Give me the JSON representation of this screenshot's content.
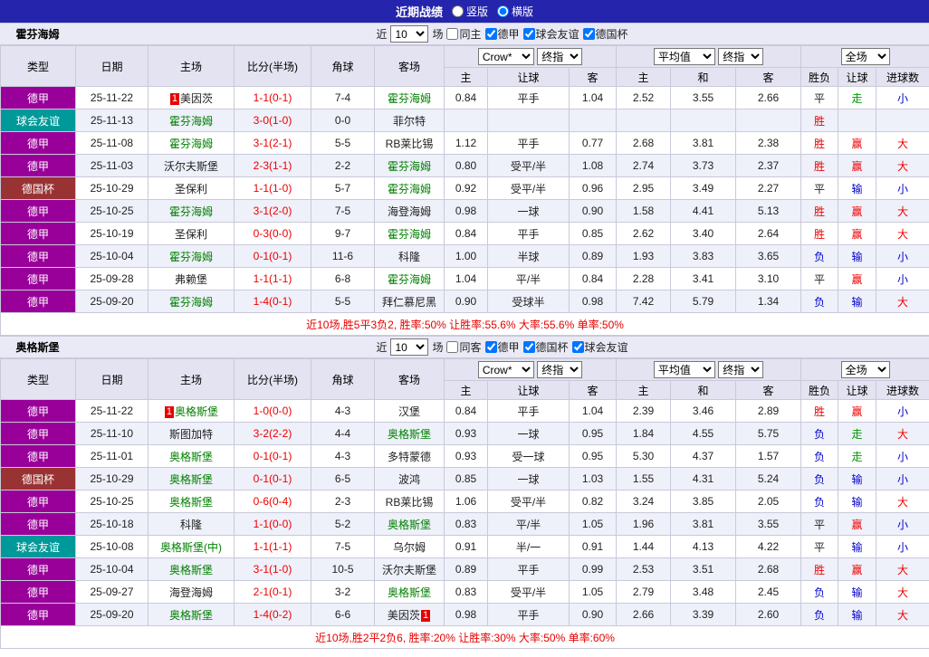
{
  "topbar": {
    "title": "近期战绩",
    "radios": [
      {
        "label": "竖版",
        "checked": false
      },
      {
        "label": "横版",
        "checked": true
      }
    ]
  },
  "colors": {
    "topbar_bg": "#2424ac",
    "leagues": {
      "德甲": "#990099",
      "球会友谊": "#009999",
      "德国杯": "#993333"
    },
    "focus_team": "#008000",
    "score": "#ee0000",
    "summary": "#e60000",
    "results": {
      "胜": "#ee0000",
      "平": "#222222",
      "负": "#0000cc",
      "赢": "#ee0000",
      "走": "#009900",
      "输": "#0000cc",
      "大": "#ee0000",
      "小": "#0000cc"
    }
  },
  "table_header": {
    "cols": [
      "类型",
      "日期",
      "主场",
      "比分(半场)",
      "角球",
      "客场"
    ],
    "selects": {
      "odds_source": "Crow*",
      "odds_stage": "终指",
      "avg_source": "平均值",
      "avg_stage": "终指",
      "scope": "全场"
    },
    "sub": [
      "主",
      "让球",
      "客",
      "主",
      "和",
      "客",
      "胜负",
      "让球",
      "进球数"
    ]
  },
  "sections": [
    {
      "team": "霍芬海姆",
      "filters": {
        "prefix": "近",
        "count": "10",
        "suffix": "场",
        "same_label": "同主",
        "same_checked": false,
        "leagues": [
          {
            "label": "德甲",
            "checked": true
          },
          {
            "label": "球会友谊",
            "checked": true
          },
          {
            "label": "德国杯",
            "checked": true
          }
        ]
      },
      "rows": [
        {
          "league": "德甲",
          "date": "25-11-22",
          "home": "美因茨",
          "home_focus": false,
          "home_badge": "1",
          "home_badge_pos": "before",
          "score": "1-1(0-1)",
          "corner": "7-4",
          "away": "霍芬海姆",
          "away_focus": true,
          "o1": "0.84",
          "hc": "平手",
          "o2": "1.04",
          "m1": "2.52",
          "m2": "3.55",
          "m3": "2.66",
          "r1": "平",
          "r2": "走",
          "r3": "小"
        },
        {
          "league": "球会友谊",
          "date": "25-11-13",
          "home": "霍芬海姆",
          "home_focus": true,
          "score": "3-0(1-0)",
          "corner": "0-0",
          "away": "菲尔特",
          "away_focus": false,
          "o1": "",
          "hc": "",
          "o2": "",
          "m1": "",
          "m2": "",
          "m3": "",
          "r1": "胜",
          "r2": "",
          "r3": ""
        },
        {
          "league": "德甲",
          "date": "25-11-08",
          "home": "霍芬海姆",
          "home_focus": true,
          "score": "3-1(2-1)",
          "corner": "5-5",
          "away": "RB莱比锡",
          "away_focus": false,
          "o1": "1.12",
          "hc": "平手",
          "o2": "0.77",
          "m1": "2.68",
          "m2": "3.81",
          "m3": "2.38",
          "r1": "胜",
          "r2": "赢",
          "r3": "大"
        },
        {
          "league": "德甲",
          "date": "25-11-03",
          "home": "沃尔夫斯堡",
          "home_focus": false,
          "score": "2-3(1-1)",
          "corner": "2-2",
          "away": "霍芬海姆",
          "away_focus": true,
          "o1": "0.80",
          "hc": "受平/半",
          "o2": "1.08",
          "m1": "2.74",
          "m2": "3.73",
          "m3": "2.37",
          "r1": "胜",
          "r2": "赢",
          "r3": "大"
        },
        {
          "league": "德国杯",
          "date": "25-10-29",
          "home": "圣保利",
          "home_focus": false,
          "score": "1-1(1-0)",
          "corner": "5-7",
          "away": "霍芬海姆",
          "away_focus": true,
          "o1": "0.92",
          "hc": "受平/半",
          "o2": "0.96",
          "m1": "2.95",
          "m2": "3.49",
          "m3": "2.27",
          "r1": "平",
          "r2": "输",
          "r3": "小"
        },
        {
          "league": "德甲",
          "date": "25-10-25",
          "home": "霍芬海姆",
          "home_focus": true,
          "score": "3-1(2-0)",
          "corner": "7-5",
          "away": "海登海姆",
          "away_focus": false,
          "o1": "0.98",
          "hc": "一球",
          "o2": "0.90",
          "m1": "1.58",
          "m2": "4.41",
          "m3": "5.13",
          "r1": "胜",
          "r2": "赢",
          "r3": "大"
        },
        {
          "league": "德甲",
          "date": "25-10-19",
          "home": "圣保利",
          "home_focus": false,
          "score": "0-3(0-0)",
          "corner": "9-7",
          "away": "霍芬海姆",
          "away_focus": true,
          "o1": "0.84",
          "hc": "平手",
          "o2": "0.85",
          "m1": "2.62",
          "m2": "3.40",
          "m3": "2.64",
          "r1": "胜",
          "r2": "赢",
          "r3": "大"
        },
        {
          "league": "德甲",
          "date": "25-10-04",
          "home": "霍芬海姆",
          "home_focus": true,
          "score": "0-1(0-1)",
          "corner": "11-6",
          "away": "科隆",
          "away_focus": false,
          "o1": "1.00",
          "hc": "半球",
          "o2": "0.89",
          "m1": "1.93",
          "m2": "3.83",
          "m3": "3.65",
          "r1": "负",
          "r2": "输",
          "r3": "小"
        },
        {
          "league": "德甲",
          "date": "25-09-28",
          "home": "弗赖堡",
          "home_focus": false,
          "score": "1-1(1-1)",
          "corner": "6-8",
          "away": "霍芬海姆",
          "away_focus": true,
          "o1": "1.04",
          "hc": "平/半",
          "o2": "0.84",
          "m1": "2.28",
          "m2": "3.41",
          "m3": "3.10",
          "r1": "平",
          "r2": "赢",
          "r3": "小"
        },
        {
          "league": "德甲",
          "date": "25-09-20",
          "home": "霍芬海姆",
          "home_focus": true,
          "score": "1-4(0-1)",
          "corner": "5-5",
          "away": "拜仁慕尼黑",
          "away_focus": false,
          "o1": "0.90",
          "hc": "受球半",
          "o2": "0.98",
          "m1": "7.42",
          "m2": "5.79",
          "m3": "1.34",
          "r1": "负",
          "r2": "输",
          "r3": "大"
        }
      ],
      "summary": "近10场,胜5平3负2, 胜率:50% 让胜率:55.6% 大率:55.6% 单率:50%"
    },
    {
      "team": "奥格斯堡",
      "filters": {
        "prefix": "近",
        "count": "10",
        "suffix": "场",
        "same_label": "同客",
        "same_checked": false,
        "leagues": [
          {
            "label": "德甲",
            "checked": true
          },
          {
            "label": "德国杯",
            "checked": true
          },
          {
            "label": "球会友谊",
            "checked": true
          }
        ]
      },
      "rows": [
        {
          "league": "德甲",
          "date": "25-11-22",
          "home": "奥格斯堡",
          "home_focus": true,
          "home_badge": "1",
          "home_badge_pos": "before",
          "score": "1-0(0-0)",
          "corner": "4-3",
          "away": "汉堡",
          "away_focus": false,
          "o1": "0.84",
          "hc": "平手",
          "o2": "1.04",
          "m1": "2.39",
          "m2": "3.46",
          "m3": "2.89",
          "r1": "胜",
          "r2": "赢",
          "r3": "小"
        },
        {
          "league": "德甲",
          "date": "25-11-10",
          "home": "斯图加特",
          "home_focus": false,
          "score": "3-2(2-2)",
          "corner": "4-4",
          "away": "奥格斯堡",
          "away_focus": true,
          "o1": "0.93",
          "hc": "一球",
          "o2": "0.95",
          "m1": "1.84",
          "m2": "4.55",
          "m3": "5.75",
          "r1": "负",
          "r2": "走",
          "r3": "大"
        },
        {
          "league": "德甲",
          "date": "25-11-01",
          "home": "奥格斯堡",
          "home_focus": true,
          "score": "0-1(0-1)",
          "corner": "4-3",
          "away": "多特蒙德",
          "away_focus": false,
          "o1": "0.93",
          "hc": "受一球",
          "o2": "0.95",
          "m1": "5.30",
          "m2": "4.37",
          "m3": "1.57",
          "r1": "负",
          "r2": "走",
          "r3": "小"
        },
        {
          "league": "德国杯",
          "date": "25-10-29",
          "home": "奥格斯堡",
          "home_focus": true,
          "score": "0-1(0-1)",
          "corner": "6-5",
          "away": "波鸿",
          "away_focus": false,
          "o1": "0.85",
          "hc": "一球",
          "o2": "1.03",
          "m1": "1.55",
          "m2": "4.31",
          "m3": "5.24",
          "r1": "负",
          "r2": "输",
          "r3": "小"
        },
        {
          "league": "德甲",
          "date": "25-10-25",
          "home": "奥格斯堡",
          "home_focus": true,
          "score": "0-6(0-4)",
          "corner": "2-3",
          "away": "RB莱比锡",
          "away_focus": false,
          "o1": "1.06",
          "hc": "受平/半",
          "o2": "0.82",
          "m1": "3.24",
          "m2": "3.85",
          "m3": "2.05",
          "r1": "负",
          "r2": "输",
          "r3": "大"
        },
        {
          "league": "德甲",
          "date": "25-10-18",
          "home": "科隆",
          "home_focus": false,
          "score": "1-1(0-0)",
          "corner": "5-2",
          "away": "奥格斯堡",
          "away_focus": true,
          "o1": "0.83",
          "hc": "平/半",
          "o2": "1.05",
          "m1": "1.96",
          "m2": "3.81",
          "m3": "3.55",
          "r1": "平",
          "r2": "赢",
          "r3": "小"
        },
        {
          "league": "球会友谊",
          "date": "25-10-08",
          "home": "奥格斯堡(中)",
          "home_focus": true,
          "score": "1-1(1-1)",
          "corner": "7-5",
          "away": "乌尔姆",
          "away_focus": false,
          "o1": "0.91",
          "hc": "半/一",
          "o2": "0.91",
          "m1": "1.44",
          "m2": "4.13",
          "m3": "4.22",
          "r1": "平",
          "r2": "输",
          "r3": "小"
        },
        {
          "league": "德甲",
          "date": "25-10-04",
          "home": "奥格斯堡",
          "home_focus": true,
          "score": "3-1(1-0)",
          "corner": "10-5",
          "away": "沃尔夫斯堡",
          "away_focus": false,
          "o1": "0.89",
          "hc": "平手",
          "o2": "0.99",
          "m1": "2.53",
          "m2": "3.51",
          "m3": "2.68",
          "r1": "胜",
          "r2": "赢",
          "r3": "大"
        },
        {
          "league": "德甲",
          "date": "25-09-27",
          "home": "海登海姆",
          "home_focus": false,
          "score": "2-1(0-1)",
          "corner": "3-2",
          "away": "奥格斯堡",
          "away_focus": true,
          "o1": "0.83",
          "hc": "受平/半",
          "o2": "1.05",
          "m1": "2.79",
          "m2": "3.48",
          "m3": "2.45",
          "r1": "负",
          "r2": "输",
          "r3": "大"
        },
        {
          "league": "德甲",
          "date": "25-09-20",
          "home": "奥格斯堡",
          "home_focus": true,
          "score": "1-4(0-2)",
          "corner": "6-6",
          "away": "美因茨",
          "away_focus": false,
          "away_badge": "1",
          "away_badge_pos": "after",
          "o1": "0.98",
          "hc": "平手",
          "o2": "0.90",
          "m1": "2.66",
          "m2": "3.39",
          "m3": "2.60",
          "r1": "负",
          "r2": "输",
          "r3": "大"
        }
      ],
      "summary": "近10场,胜2平2负6, 胜率:20% 让胜率:30% 大率:50% 单率:60%"
    }
  ]
}
